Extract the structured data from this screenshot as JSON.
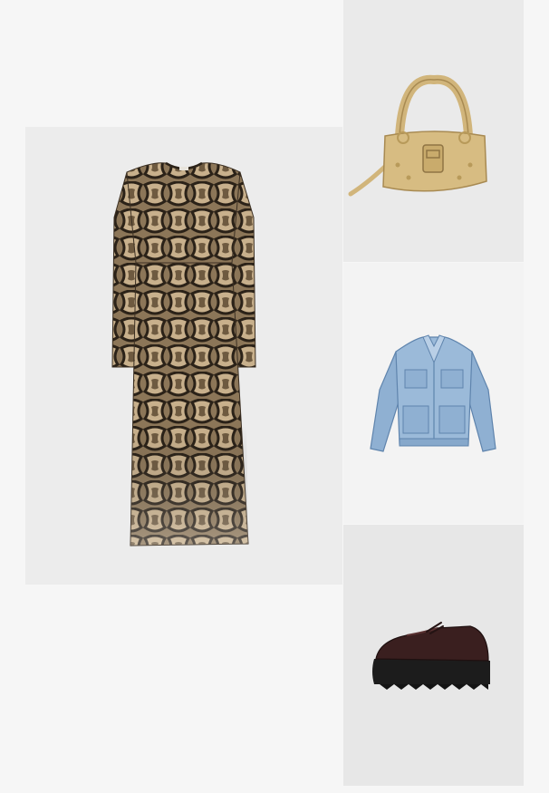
{
  "outfit": {
    "items": [
      {
        "id": "dress",
        "kind": "dress",
        "pattern": "snake-print",
        "colors": {
          "base": "#8c7658",
          "dark": "#2b2218",
          "light": "#c8b08c"
        }
      },
      {
        "id": "bag",
        "kind": "handbag",
        "colors": {
          "base": "#d7bc82",
          "dark": "#a88a52",
          "hardware": "#b89a5a"
        }
      },
      {
        "id": "jacket",
        "kind": "denim-jacket",
        "colors": {
          "base": "#8fb0d2",
          "dark": "#5f84ad",
          "light": "#b9cfe6"
        }
      },
      {
        "id": "shoe",
        "kind": "platform-shoe",
        "colors": {
          "upper": "#3a1f1f",
          "sole": "#1c1c1c"
        }
      }
    ]
  }
}
